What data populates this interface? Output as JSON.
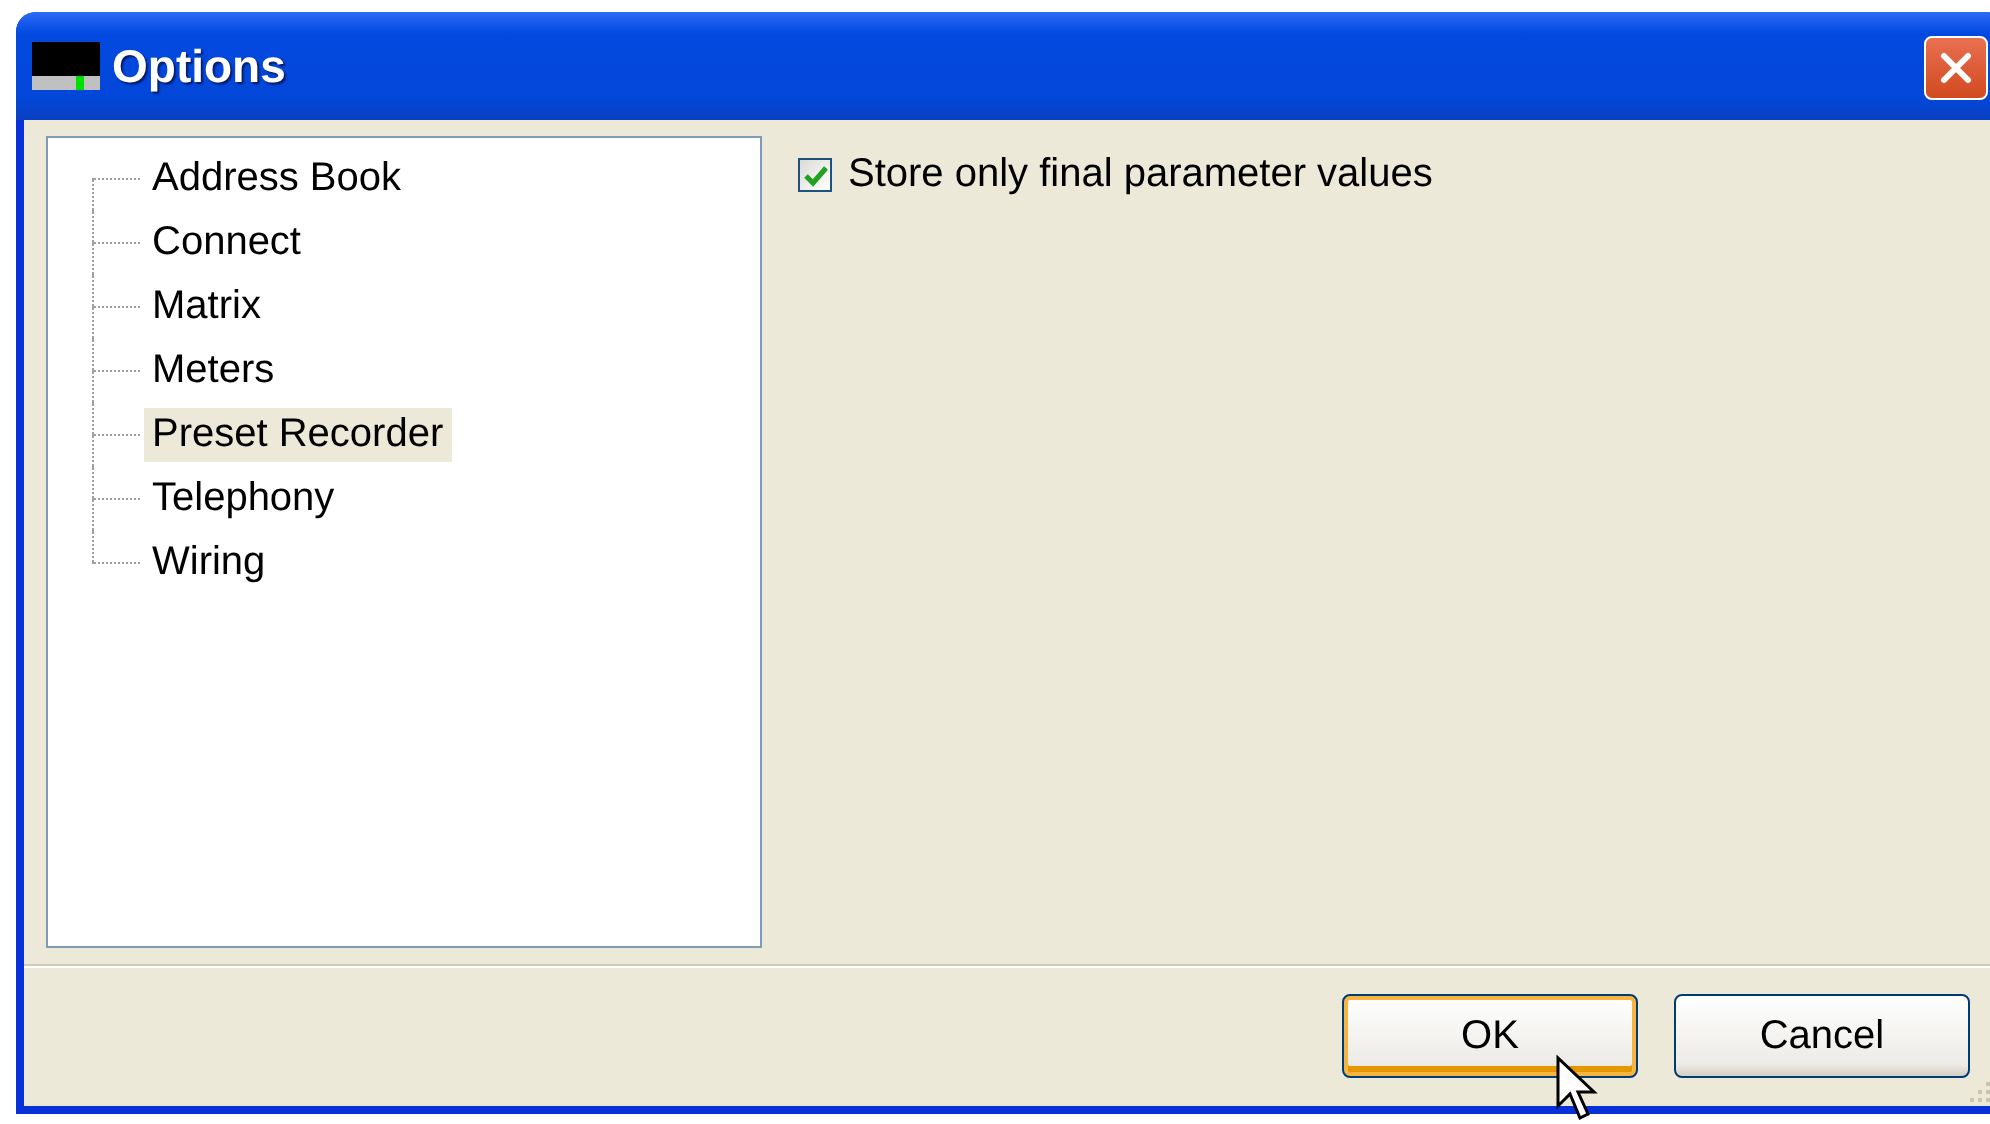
{
  "window": {
    "title": "Options"
  },
  "tree": {
    "items": [
      {
        "label": "Address Book",
        "selected": false
      },
      {
        "label": "Connect",
        "selected": false
      },
      {
        "label": "Matrix",
        "selected": false
      },
      {
        "label": "Meters",
        "selected": false
      },
      {
        "label": "Preset Recorder",
        "selected": true
      },
      {
        "label": "Telephony",
        "selected": false
      },
      {
        "label": "Wiring",
        "selected": false
      }
    ]
  },
  "settings": [
    {
      "kind": "checkbox",
      "label": "Store only final parameter values",
      "checked": true
    }
  ],
  "buttons": [
    {
      "label": "OK",
      "default": true
    },
    {
      "label": "Cancel",
      "default": false
    }
  ]
}
